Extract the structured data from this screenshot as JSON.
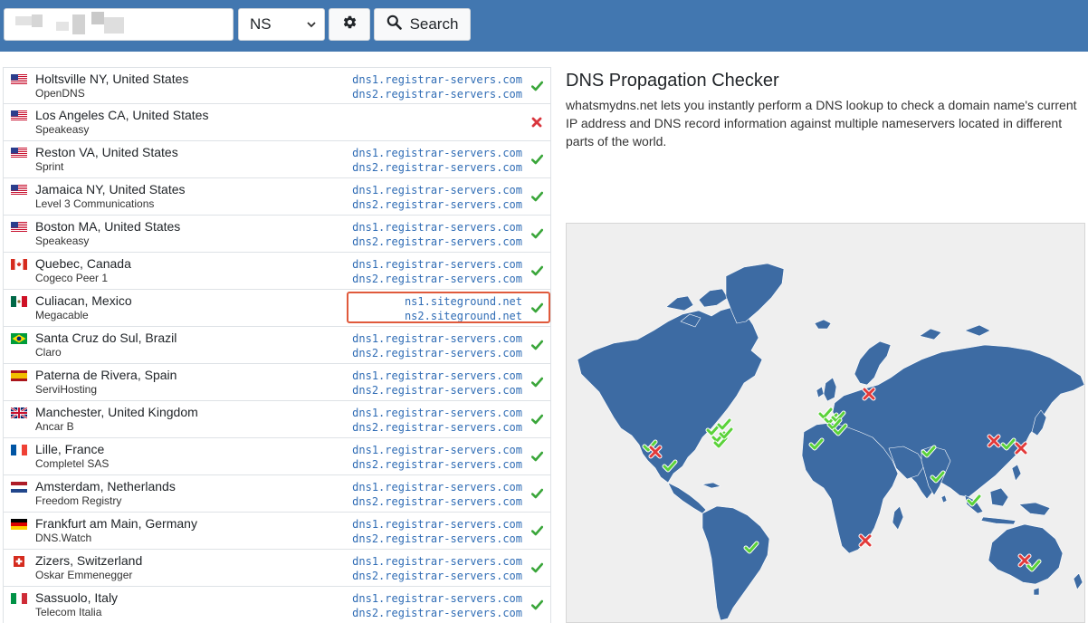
{
  "search": {
    "domain_value": "",
    "record_type": "NS",
    "settings_icon": "gear-icon",
    "search_icon": "search-icon",
    "search_label": "Search"
  },
  "results": [
    {
      "location": "Holtsville NY, United States",
      "provider": "OpenDNS",
      "flag": "us",
      "records": [
        "dns1.registrar-servers.com",
        "dns2.registrar-servers.com"
      ],
      "status": "ok"
    },
    {
      "location": "Los Angeles CA, United States",
      "provider": "Speakeasy",
      "flag": "us",
      "records": [],
      "status": "fail"
    },
    {
      "location": "Reston VA, United States",
      "provider": "Sprint",
      "flag": "us",
      "records": [
        "dns1.registrar-servers.com",
        "dns2.registrar-servers.com"
      ],
      "status": "ok"
    },
    {
      "location": "Jamaica NY, United States",
      "provider": "Level 3 Communications",
      "flag": "us",
      "records": [
        "dns1.registrar-servers.com",
        "dns2.registrar-servers.com"
      ],
      "status": "ok"
    },
    {
      "location": "Boston MA, United States",
      "provider": "Speakeasy",
      "flag": "us",
      "records": [
        "dns1.registrar-servers.com",
        "dns2.registrar-servers.com"
      ],
      "status": "ok"
    },
    {
      "location": "Quebec, Canada",
      "provider": "Cogeco Peer 1",
      "flag": "ca",
      "records": [
        "dns1.registrar-servers.com",
        "dns2.registrar-servers.com"
      ],
      "status": "ok"
    },
    {
      "location": "Culiacan, Mexico",
      "provider": "Megacable",
      "flag": "mx",
      "records": [
        "ns1.siteground.net",
        "ns2.siteground.net"
      ],
      "status": "ok",
      "highlighted": true
    },
    {
      "location": "Santa Cruz do Sul, Brazil",
      "provider": "Claro",
      "flag": "br",
      "records": [
        "dns1.registrar-servers.com",
        "dns2.registrar-servers.com"
      ],
      "status": "ok"
    },
    {
      "location": "Paterna de Rivera, Spain",
      "provider": "ServiHosting",
      "flag": "es",
      "records": [
        "dns1.registrar-servers.com",
        "dns2.registrar-servers.com"
      ],
      "status": "ok"
    },
    {
      "location": "Manchester, United Kingdom",
      "provider": "Ancar B",
      "flag": "gb",
      "records": [
        "dns1.registrar-servers.com",
        "dns2.registrar-servers.com"
      ],
      "status": "ok"
    },
    {
      "location": "Lille, France",
      "provider": "Completel SAS",
      "flag": "fr",
      "records": [
        "dns1.registrar-servers.com",
        "dns2.registrar-servers.com"
      ],
      "status": "ok"
    },
    {
      "location": "Amsterdam, Netherlands",
      "provider": "Freedom Registry",
      "flag": "nl",
      "records": [
        "dns1.registrar-servers.com",
        "dns2.registrar-servers.com"
      ],
      "status": "ok"
    },
    {
      "location": "Frankfurt am Main, Germany",
      "provider": "DNS.Watch",
      "flag": "de",
      "records": [
        "dns1.registrar-servers.com",
        "dns2.registrar-servers.com"
      ],
      "status": "ok"
    },
    {
      "location": "Zizers, Switzerland",
      "provider": "Oskar Emmenegger",
      "flag": "ch",
      "records": [
        "dns1.registrar-servers.com",
        "dns2.registrar-servers.com"
      ],
      "status": "ok"
    },
    {
      "location": "Sassuolo, Italy",
      "provider": "Telecom Italia",
      "flag": "it",
      "records": [
        "dns1.registrar-servers.com",
        "dns2.registrar-servers.com"
      ],
      "status": "ok"
    }
  ],
  "info": {
    "title": "DNS Propagation Checker",
    "description": "whatsmydns.net lets you instantly perform a DNS lookup to check a domain name's current IP address and DNS record information against multiple nameservers located in different parts of the world."
  },
  "colors": {
    "header": "#4277b0",
    "record_link": "#2f6cb5",
    "success": "#3aa63a",
    "failure": "#d9363e",
    "highlight": "#e05a3c",
    "map_land": "#3d6ba3",
    "map_sea": "#efefef"
  },
  "map_markers": [
    {
      "status": "ok"
    },
    {
      "status": "fail"
    },
    {
      "status": "ok"
    },
    {
      "status": "ok"
    },
    {
      "status": "ok"
    },
    {
      "status": "ok"
    },
    {
      "status": "ok"
    },
    {
      "status": "ok"
    },
    {
      "status": "ok"
    },
    {
      "status": "ok"
    },
    {
      "status": "ok"
    },
    {
      "status": "ok"
    },
    {
      "status": "ok"
    },
    {
      "status": "ok"
    },
    {
      "status": "ok"
    },
    {
      "status": "fail"
    },
    {
      "status": "ok"
    },
    {
      "status": "ok"
    },
    {
      "status": "fail"
    },
    {
      "status": "ok"
    },
    {
      "status": "fail"
    },
    {
      "status": "ok"
    },
    {
      "status": "fail"
    },
    {
      "status": "ok"
    },
    {
      "status": "fail"
    }
  ]
}
